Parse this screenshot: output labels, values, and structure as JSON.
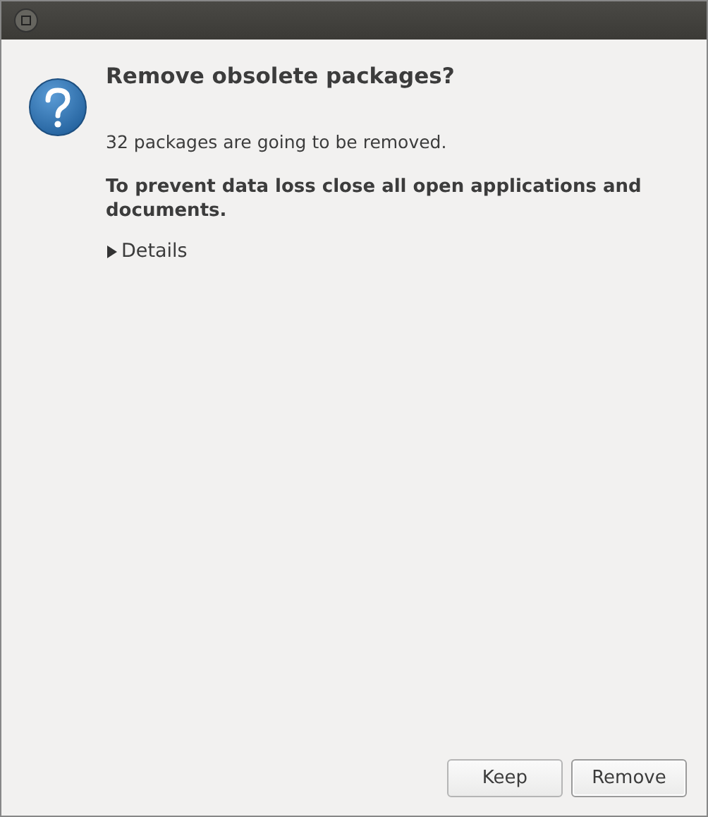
{
  "dialog": {
    "title": "Remove obsolete packages?",
    "message": "32 packages are going to be removed.",
    "warning": "To prevent data loss close all open applications and documents.",
    "details": {
      "label": "Details",
      "expanded": false
    }
  },
  "buttons": [
    {
      "label": "Keep",
      "kind": "normal"
    },
    {
      "label": "Remove",
      "kind": "default"
    }
  ]
}
